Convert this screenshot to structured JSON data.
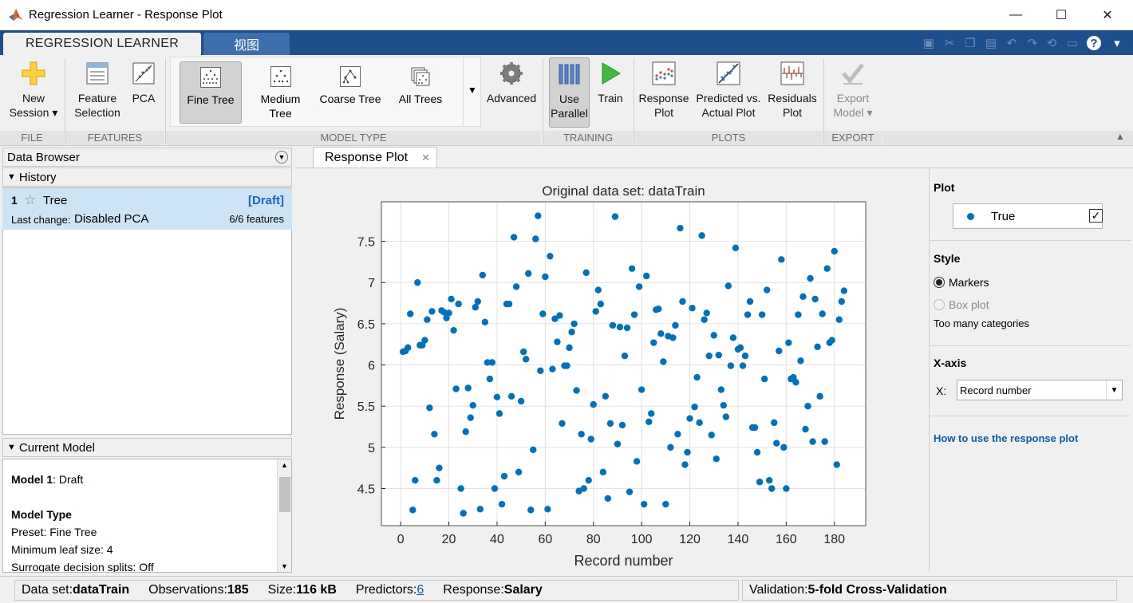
{
  "window": {
    "title": "Regression Learner - Response Plot",
    "min": "—",
    "max": "☐",
    "close": "✕"
  },
  "tabs": [
    {
      "label": "REGRESSION LEARNER"
    },
    {
      "label": "视图"
    }
  ],
  "ribbon": {
    "file": {
      "new_line1": "New",
      "new_line2": "Session ▾",
      "section": "FILE"
    },
    "features": {
      "fs_line1": "Feature",
      "fs_line2": "Selection",
      "pca": "PCA",
      "section": "FEATURES"
    },
    "model_type": {
      "items": [
        {
          "label1": "Fine Tree",
          "label2": ""
        },
        {
          "label1": "Medium",
          "label2": "Tree"
        },
        {
          "label1": "Coarse Tree",
          "label2": ""
        },
        {
          "label1": "All Trees",
          "label2": ""
        }
      ],
      "advanced": "Advanced",
      "section": "MODEL TYPE"
    },
    "training": {
      "use_line1": "Use",
      "use_line2": "Parallel",
      "train": "Train",
      "section": "TRAINING"
    },
    "plots": {
      "resp_line1": "Response",
      "resp_line2": "Plot",
      "pva_line1": "Predicted vs.",
      "pva_line2": "Actual Plot",
      "res_line1": "Residuals",
      "res_line2": "Plot",
      "section": "PLOTS"
    },
    "export": {
      "line1": "Export",
      "line2": "Model ▾",
      "section": "EXPORT"
    }
  },
  "data_browser": {
    "title": "Data Browser",
    "history_label": "History",
    "item": {
      "num": "1",
      "name": "Tree",
      "status": "[Draft]",
      "change_label": "Last change:",
      "change_value": "Disabled PCA",
      "features": "6/6 features"
    }
  },
  "current_model": {
    "title": "Current Model",
    "lines": [
      {
        "bold": "Model 1",
        "rest": ": Draft"
      },
      {
        "bold": "",
        "rest": ""
      },
      {
        "bold": "Model Type",
        "rest": ""
      },
      {
        "bold": "",
        "rest": "Preset: Fine Tree"
      },
      {
        "bold": "",
        "rest": "Minimum leaf size: 4"
      },
      {
        "bold": "",
        "rest": "Surrogate decision splits: Off"
      }
    ]
  },
  "doc_tab": {
    "label": "Response Plot",
    "close": "✕"
  },
  "right_panel": {
    "plot_heading": "Plot",
    "legend_label": "True",
    "style_heading": "Style",
    "markers": "Markers",
    "boxplot": "Box plot",
    "too_many": "Too many categories",
    "xaxis_heading": "X-axis",
    "x_label": "X:",
    "x_value": "Record number",
    "help_link": "How to use the response plot"
  },
  "status": {
    "dataset_label": "Data set: ",
    "dataset_value": "dataTrain",
    "obs_label": "Observations: ",
    "obs_value": "185",
    "size_label": "Size: ",
    "size_value": "116 kB",
    "pred_label": "Predictors: ",
    "pred_value": "6",
    "resp_label": "Response: ",
    "resp_value": "Salary",
    "val_label": "Validation: ",
    "val_value": "5-fold Cross-Validation"
  },
  "colors": {
    "marker": "#0072bd",
    "link": "#0b5cad",
    "selected": "#cce4f3"
  },
  "chart_data": {
    "type": "scatter",
    "title": "Original data set: dataTrain",
    "xlabel": "Record number",
    "ylabel": "Response (Salary)",
    "xlim": [
      -8,
      193
    ],
    "ylim": [
      4.05,
      7.98
    ],
    "xticks": [
      "0",
      "20",
      "40",
      "60",
      "80",
      "100",
      "120",
      "140",
      "160",
      "180"
    ],
    "xtick_values": [
      0,
      20,
      40,
      60,
      80,
      100,
      120,
      140,
      160,
      180
    ],
    "yticks": [
      "4.5",
      "5",
      "5.5",
      "6",
      "6.5",
      "7",
      "7.5"
    ],
    "ytick_values": [
      4.5,
      5,
      5.5,
      6,
      6.5,
      7,
      7.5
    ],
    "grid": true,
    "series": [
      {
        "name": "True",
        "values": [
          6.16,
          6.17,
          6.21,
          6.62,
          4.24,
          4.6,
          7.0,
          6.24,
          6.24,
          6.3,
          6.55,
          5.48,
          6.65,
          5.16,
          4.6,
          4.75,
          6.66,
          6.64,
          6.57,
          6.63,
          6.8,
          6.42,
          5.71,
          6.74,
          4.5,
          4.2,
          5.19,
          5.72,
          5.36,
          5.51,
          6.7,
          6.77,
          4.25,
          7.09,
          6.52,
          6.03,
          5.83,
          6.03,
          4.5,
          5.61,
          5.41,
          4.31,
          4.65,
          6.74,
          6.74,
          5.62,
          7.55,
          6.95,
          4.7,
          5.56,
          6.16,
          6.07,
          7.11,
          4.24,
          4.97,
          7.53,
          7.81,
          5.93,
          6.62,
          7.07,
          4.25,
          7.32,
          5.95,
          6.56,
          6.28,
          6.6,
          5.29,
          5.99,
          5.99,
          6.21,
          6.4,
          6.5,
          5.69,
          4.47,
          5.16,
          4.5,
          7.12,
          4.6,
          5.1,
          5.52,
          6.65,
          6.91,
          6.74,
          4.7,
          5.62,
          4.38,
          5.29,
          6.48,
          7.8,
          5.04,
          6.46,
          5.27,
          6.11,
          6.45,
          4.46,
          7.17,
          6.61,
          4.83,
          6.95,
          5.7,
          4.31,
          7.08,
          5.31,
          5.41,
          6.27,
          6.67,
          6.68,
          6.38,
          6.04,
          4.31,
          6.35,
          5.0,
          6.33,
          6.48,
          5.16,
          7.66,
          6.77,
          4.79,
          4.94,
          5.35,
          6.69,
          5.49,
          5.85,
          5.3,
          7.57,
          6.55,
          6.63,
          6.11,
          5.15,
          6.36,
          4.86,
          6.12,
          5.7,
          5.51,
          5.37,
          6.96,
          5.99,
          6.33,
          7.42,
          6.19,
          6.21,
          5.99,
          6.11,
          6.61,
          6.77,
          5.24,
          5.24,
          4.94,
          4.58,
          6.61,
          5.83,
          6.91,
          4.6,
          4.5,
          5.3,
          5.05,
          6.17,
          7.28,
          5.0,
          4.5,
          6.27,
          5.83,
          5.85,
          5.79,
          6.61,
          6.05,
          6.83,
          5.22,
          5.5,
          7.05,
          5.07,
          6.8,
          6.22,
          5.62,
          6.62,
          5.07,
          7.17,
          6.27,
          6.3,
          7.38,
          4.79,
          6.55,
          6.77,
          6.9
        ]
      }
    ]
  }
}
